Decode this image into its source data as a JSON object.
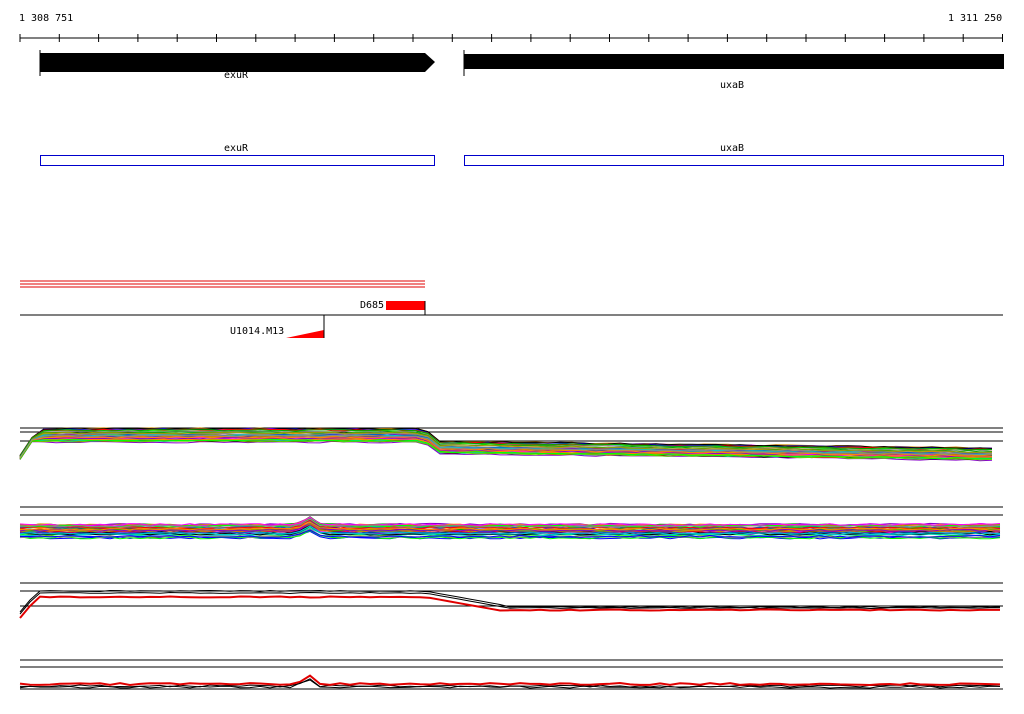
{
  "ruler": {
    "start_label": "1 308 751",
    "end_label": "1 311 250"
  },
  "genes": [
    {
      "name": "exuR",
      "strand": "+"
    },
    {
      "name": "uxaB",
      "strand": "+"
    }
  ],
  "gene_models": [
    {
      "name": "exuR"
    },
    {
      "name": "uxaB"
    }
  ],
  "features": {
    "d685_label": "D685",
    "u1014_label": "U1014.M13"
  },
  "colors": {
    "gene_arrow": "#000000",
    "gene_model": "#0000cc",
    "feature": "#ff0000",
    "baseline": "#000000"
  }
}
